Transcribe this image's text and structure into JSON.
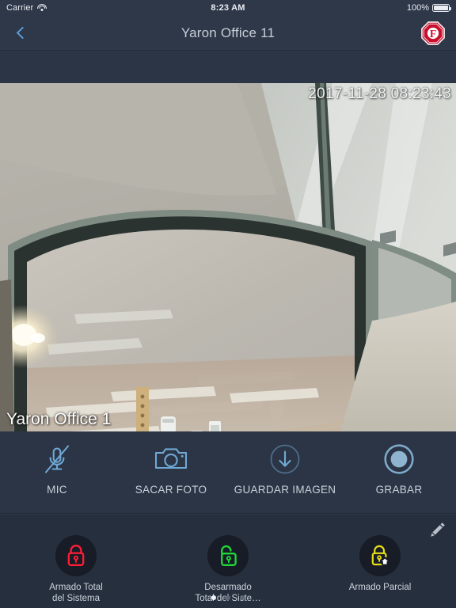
{
  "status_bar": {
    "carrier": "Carrier",
    "wifi_icon": "wifi-icon",
    "time": "8:23 AM",
    "battery_percent": "100%",
    "battery_icon": "battery-full-icon"
  },
  "nav_bar": {
    "back_icon": "chevron-left-icon",
    "title": "Yaron Office 11",
    "logo_icon": "octagon-f-logo-icon",
    "logo_letter": "F",
    "logo_color": "#c8102e"
  },
  "video": {
    "timestamp": "2017-11-28 08:23:43",
    "camera_name": "Yaron Office 1"
  },
  "controls": [
    {
      "id": "mic",
      "label": "MIC",
      "icon": "microphone-muted-icon"
    },
    {
      "id": "sacar-foto",
      "label": "SACAR FOTO",
      "icon": "camera-icon"
    },
    {
      "id": "guardar-imagen",
      "label": "GUARDAR IMAGEN",
      "icon": "download-circle-icon"
    },
    {
      "id": "grabar",
      "label": "GRABAR",
      "icon": "record-circle-icon"
    }
  ],
  "bottom_panel": {
    "edit_icon": "pencil-edit-icon",
    "actions": [
      {
        "id": "armado-total",
        "label_line1": "Armado Total",
        "label_line2": "del Sistema",
        "icon": "lock-closed-icon",
        "color": "#ff1d36"
      },
      {
        "id": "desarmado-total",
        "label_line1": "Desarmado",
        "label_line2": "Total del Siste…",
        "icon": "lock-open-icon",
        "color": "#1fd83a"
      },
      {
        "id": "armado-parcial",
        "label_line1": "Armado Parcial",
        "label_line2": "",
        "icon": "lock-home-icon",
        "color": "#e8e015"
      }
    ],
    "page_dots": {
      "count": 3,
      "active_index": 0
    }
  },
  "theme": {
    "status_bg": "#2f3848",
    "nav_bg": "#2f3848",
    "body_bg": "#2b3545",
    "panel_bg": "#262f3d",
    "accent_blue": "#6fa8d4",
    "text_light": "#c9d0da"
  }
}
